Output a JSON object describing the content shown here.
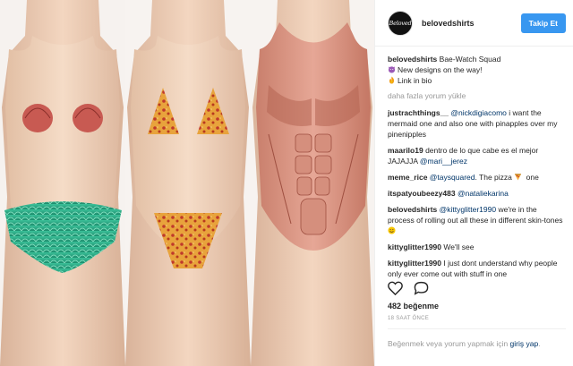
{
  "post": {
    "username": "belovedshirts",
    "avatar_text": "Beloved",
    "follow_label": "Takip Et",
    "caption": {
      "username": "belovedshirts",
      "title": "Bae-Watch Squad",
      "line2": "New designs on the way!",
      "line3": "Link in bio"
    },
    "load_more": "daha fazla yorum yükle",
    "comments": [
      {
        "user": "justrachthings__",
        "mention": "@nickdigiacomo",
        "text": " i want the mermaid one and also one with pinapples over my pinenipples"
      },
      {
        "user": "maarilo19",
        "mention": "",
        "text": "dentro de lo que cabe es el mejor JAJAJJA ",
        "mention_after": "@mari__jerez"
      },
      {
        "user": "meme_rice",
        "mention": "@taysquared",
        "text": ". The pizza ",
        "text_after": " one"
      },
      {
        "user": "itspatyoubeezy483",
        "mention": "@nataliekarina",
        "text": ""
      },
      {
        "user": "belovedshirts",
        "mention": "@kittyglitter1990",
        "text": " we're in the process of rolling out all these in different skin-tones "
      },
      {
        "user": "kittyglitter1990",
        "mention": "",
        "text": "We'll see"
      },
      {
        "user": "kittyglitter1990",
        "mention": "",
        "text": "I just dont understand why people only ever come out with stuff in one"
      }
    ],
    "likes": "482 beğenme",
    "time_ago": "18 SAAT ÖNCE",
    "signup_text": "Beğenmek veya yorum yapmak için ",
    "signup_link": "giriş yap",
    "signup_end": "."
  },
  "colors": {
    "accent": "#3897f0",
    "mention": "#003569",
    "muted": "#999999",
    "mermaid": "#2aa583",
    "skin": "#efcfb5"
  },
  "icons": [
    "heart-icon",
    "comment-icon",
    "devil-emoji-icon",
    "fire-emoji-icon",
    "pizza-emoji-icon",
    "smile-emoji-icon"
  ]
}
